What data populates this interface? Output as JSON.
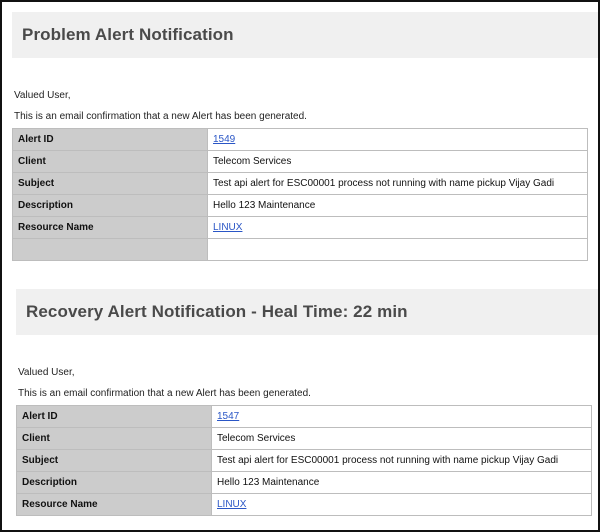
{
  "problem": {
    "title": "Problem Alert Notification",
    "greeting": "Valued User,",
    "intro": "This is an email confirmation that a new Alert has been generated.",
    "rows": [
      {
        "label": "Alert ID",
        "value": "1549",
        "link": true
      },
      {
        "label": "Client",
        "value": "Telecom Services",
        "link": false
      },
      {
        "label": "Subject",
        "value": "Test api alert for ESC00001 process not running with name pickup Vijay Gadi",
        "link": false
      },
      {
        "label": "Description",
        "value": "Hello 123 Maintenance",
        "link": false
      },
      {
        "label": "Resource Name",
        "value": "LINUX",
        "link": true
      }
    ]
  },
  "recovery": {
    "title": "Recovery Alert Notification - Heal Time: 22 min",
    "greeting": "Valued User,",
    "intro": "This is an email confirmation that a new Alert has been generated.",
    "rows": [
      {
        "label": "Alert ID",
        "value": "1547",
        "link": true
      },
      {
        "label": "Client",
        "value": "Telecom Services",
        "link": false
      },
      {
        "label": "Subject",
        "value": "Test api alert for ESC00001 process not running with name pickup Vijay Gadi",
        "link": false
      },
      {
        "label": "Description",
        "value": "Hello 123 Maintenance",
        "link": false
      },
      {
        "label": "Resource Name",
        "value": "LINUX",
        "link": true
      }
    ]
  }
}
